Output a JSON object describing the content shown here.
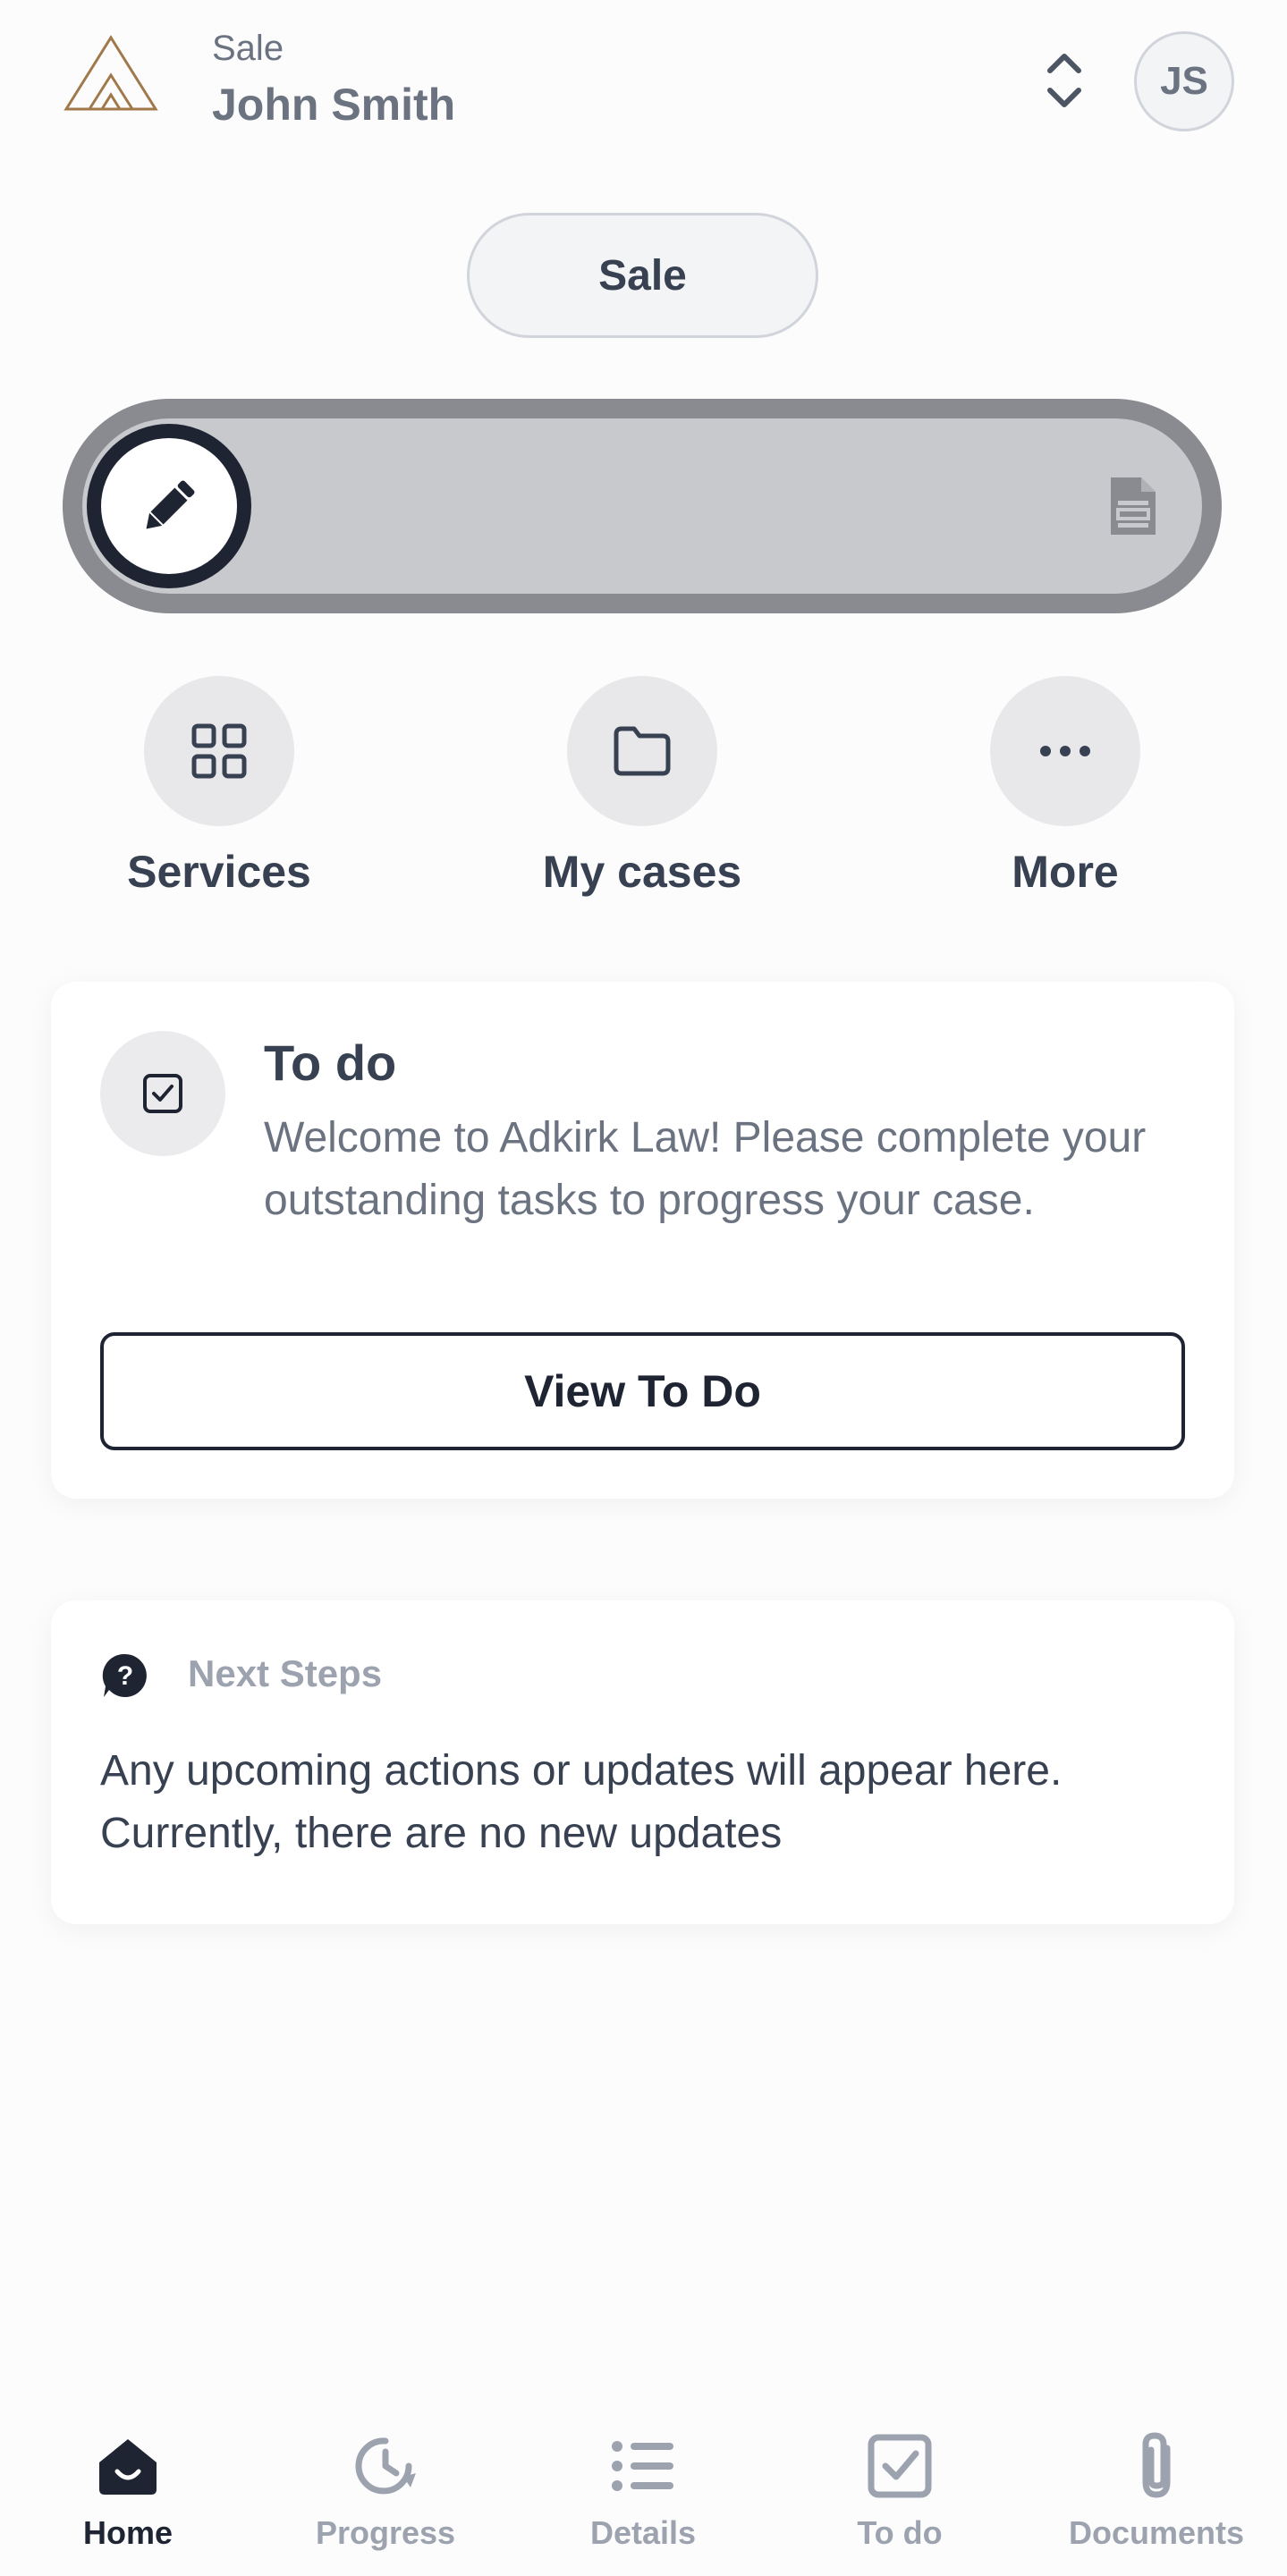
{
  "header": {
    "subtitle": "Sale",
    "name": "John Smith",
    "avatar_initials": "JS",
    "logo_color": "#a0784a"
  },
  "sale_pill": {
    "label": "Sale"
  },
  "slider": {
    "knob_icon": "pencil-icon",
    "end_icon": "document-icon"
  },
  "quick_actions": [
    {
      "label": "Services",
      "icon": "grid-icon"
    },
    {
      "label": "My cases",
      "icon": "folder-icon"
    },
    {
      "label": "More",
      "icon": "more-dots-icon"
    }
  ],
  "todo_card": {
    "title": "To do",
    "description": "Welcome to Adkirk Law! Please complete your outstanding tasks to progress your case.",
    "button_label": "View To Do",
    "icon": "checkbox-icon"
  },
  "next_steps": {
    "title": "Next Steps",
    "description": "Any upcoming actions or updates will appear here. Currently, there are no new updates",
    "icon": "question-chat-icon"
  },
  "bottom_nav": [
    {
      "label": "Home",
      "icon": "home-icon",
      "active": true
    },
    {
      "label": "Progress",
      "icon": "progress-clock-icon",
      "active": false
    },
    {
      "label": "Details",
      "icon": "list-icon",
      "active": false
    },
    {
      "label": "To do",
      "icon": "checkbox-icon",
      "active": false
    },
    {
      "label": "Documents",
      "icon": "paperclip-icon",
      "active": false
    }
  ],
  "colors": {
    "primary_dark": "#1f2433",
    "text_muted": "#6b7280",
    "text_light": "#9ca3af",
    "accent_gold": "#a0784a"
  }
}
